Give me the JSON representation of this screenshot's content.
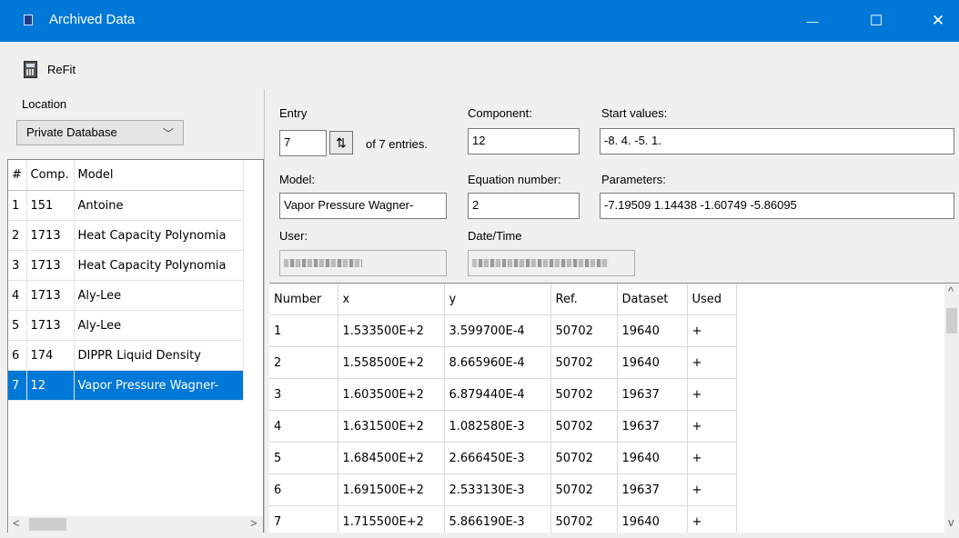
{
  "window": {
    "title": "Archived Data",
    "minimize": "—",
    "maximize": "☐",
    "close": "✕"
  },
  "toolbar": {
    "refit_label": "ReFit"
  },
  "location": {
    "label": "Location",
    "selected": "Private Database",
    "chevron": "﹀"
  },
  "left_list": {
    "headers": [
      "#",
      "Comp.",
      "Model"
    ],
    "rows": [
      [
        "1",
        "151",
        "Antoine"
      ],
      [
        "2",
        "1713",
        "Heat Capacity Polynomia"
      ],
      [
        "3",
        "1713",
        "Heat Capacity Polynomia"
      ],
      [
        "4",
        "1713",
        "Aly-Lee"
      ],
      [
        "5",
        "1713",
        "Aly-Lee"
      ],
      [
        "6",
        "174",
        "DIPPR Liquid Density"
      ],
      [
        "7",
        "12",
        "Vapor Pressure Wagner-"
      ]
    ],
    "selected_index": 6,
    "scroll_left": "<",
    "scroll_right": ">"
  },
  "form": {
    "entry_label": "Entry",
    "entry_value": "7",
    "entry_spin": "⇅",
    "of_entries": "of 7 entries.",
    "component_label": "Component:",
    "component_value": "12",
    "start_values_label": "Start values:",
    "start_values_value": "-8. 4. -5. 1.",
    "model_label": "Model:",
    "model_value": "Vapor Pressure Wagner-",
    "equation_label": "Equation number:",
    "equation_value": "2",
    "parameters_label": "Parameters:",
    "parameters_value": "-7.19509 1.14438 -1.60749 -5.86095",
    "user_label": "User:",
    "datetime_label": "Date/Time"
  },
  "data_grid": {
    "headers": [
      "Number",
      "x",
      "y",
      "Ref.",
      "Dataset",
      "Used"
    ],
    "rows": [
      [
        "1",
        "1.533500E+2",
        "3.599700E-4",
        "50702",
        "19640",
        "+"
      ],
      [
        "2",
        "1.558500E+2",
        "8.665960E-4",
        "50702",
        "19640",
        "+"
      ],
      [
        "3",
        "1.603500E+2",
        "6.879440E-4",
        "50702",
        "19637",
        "+"
      ],
      [
        "4",
        "1.631500E+2",
        "1.082580E-3",
        "50702",
        "19637",
        "+"
      ],
      [
        "5",
        "1.684500E+2",
        "2.666450E-3",
        "50702",
        "19640",
        "+"
      ],
      [
        "6",
        "1.691500E+2",
        "2.533130E-3",
        "50702",
        "19637",
        "+"
      ],
      [
        "7",
        "1.715500E+2",
        "5.866190E-3",
        "50702",
        "19640",
        "+"
      ]
    ],
    "scroll_up": "^",
    "scroll_down": "v"
  },
  "colors": {
    "titlebar": "#0078d7",
    "selection": "#0078d7"
  }
}
